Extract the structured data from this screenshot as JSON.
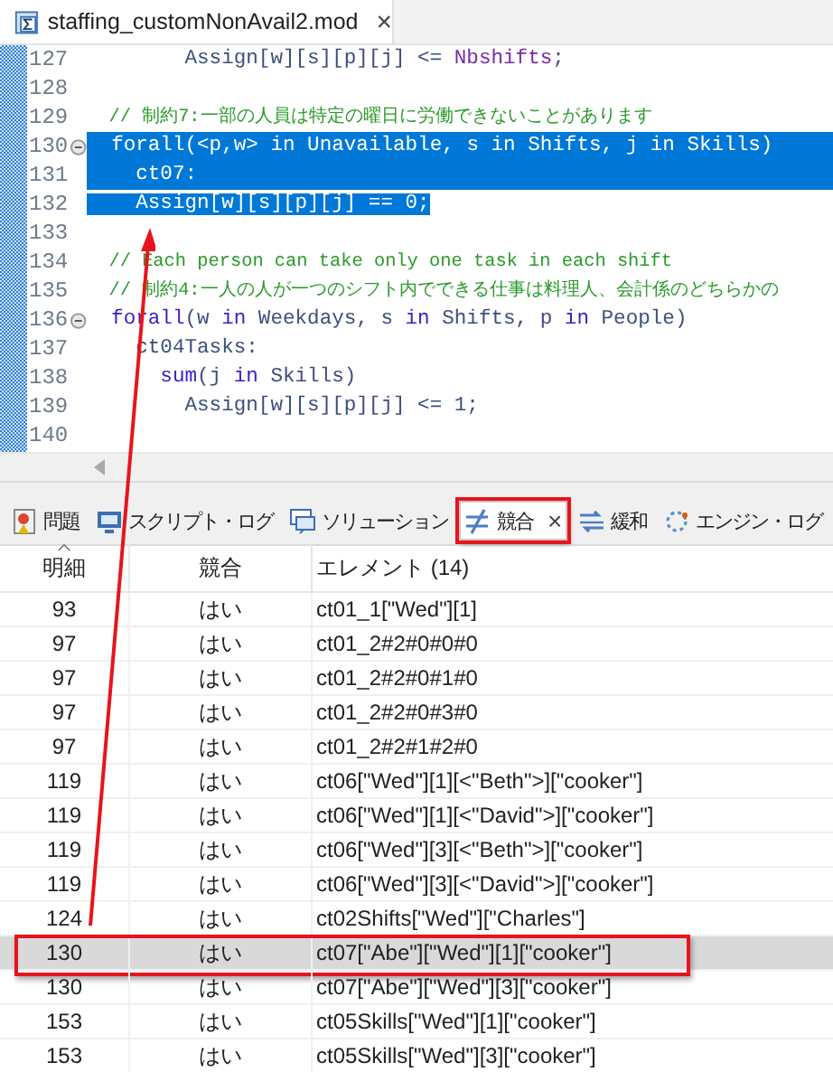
{
  "editor_tab": {
    "title": "staffing_customNonAvail2.mod",
    "close": "×"
  },
  "code_lines": [
    {
      "number": "127",
      "fold": false,
      "selected_to_end": false,
      "tokens": [
        {
          "kind": "plain",
          "text": "        Assign[w][s][p][j] <= ",
          "selected": false
        },
        {
          "kind": "ident",
          "text": "Nbshifts",
          "selected": false
        },
        {
          "kind": "plain",
          "text": ";",
          "selected": false
        }
      ]
    },
    {
      "number": "128",
      "fold": false,
      "selected_to_end": false
    },
    {
      "number": "129",
      "fold": false,
      "selected_to_end": false,
      "tokens": [
        {
          "kind": "comment",
          "text": "  // 制約7:一部の人員は特定の曜日に労働できないことがあります",
          "selected": false
        }
      ]
    },
    {
      "number": "130",
      "fold": true,
      "selected_to_end": true,
      "indent_selected": false,
      "tokens": [
        {
          "kind": "keyword",
          "text": "  forall",
          "selected": true
        },
        {
          "kind": "plain",
          "text": "(<p,w> ",
          "selected": true
        },
        {
          "kind": "keyword",
          "text": "in",
          "selected": true
        },
        {
          "kind": "plain",
          "text": " Unavailable, s ",
          "selected": true
        },
        {
          "kind": "keyword",
          "text": "in",
          "selected": true
        },
        {
          "kind": "plain",
          "text": " Shifts, j ",
          "selected": true
        },
        {
          "kind": "keyword",
          "text": "in",
          "selected": true
        },
        {
          "kind": "plain",
          "text": " Skills)",
          "selected": true
        }
      ]
    },
    {
      "number": "131",
      "fold": false,
      "selected_to_end": true,
      "indent_selected": true,
      "tokens": [
        {
          "kind": "plain",
          "text": "    ct07:",
          "selected": true
        }
      ]
    },
    {
      "number": "132",
      "fold": false,
      "selected_to_end": false,
      "indent_selected": true,
      "tokens": [
        {
          "kind": "plain",
          "text": "    Assign[w][s][p][j] == 0;",
          "selected": true
        }
      ]
    },
    {
      "number": "133",
      "fold": false,
      "selected_to_end": false
    },
    {
      "number": "134",
      "fold": false,
      "selected_to_end": false,
      "tokens": [
        {
          "kind": "comment",
          "text": "  // Each person can take only one task in each shift",
          "selected": false
        }
      ]
    },
    {
      "number": "135",
      "fold": false,
      "selected_to_end": false,
      "tokens": [
        {
          "kind": "comment",
          "text": "  // 制約4:一人の人が一つのシフト内でできる仕事は料理人、会計係のどちらかの",
          "selected": false
        }
      ]
    },
    {
      "number": "136",
      "fold": true,
      "selected_to_end": false,
      "tokens": [
        {
          "kind": "keyword",
          "text": "  forall",
          "selected": false
        },
        {
          "kind": "plain",
          "text": "(w ",
          "selected": false
        },
        {
          "kind": "keyword",
          "text": "in",
          "selected": false
        },
        {
          "kind": "plain",
          "text": " Weekdays, s ",
          "selected": false
        },
        {
          "kind": "keyword",
          "text": "in",
          "selected": false
        },
        {
          "kind": "plain",
          "text": " Shifts, p ",
          "selected": false
        },
        {
          "kind": "keyword",
          "text": "in",
          "selected": false
        },
        {
          "kind": "plain",
          "text": " People)",
          "selected": false
        }
      ]
    },
    {
      "number": "137",
      "fold": false,
      "selected_to_end": false,
      "tokens": [
        {
          "kind": "plain",
          "text": "    ct04Tasks:",
          "selected": false
        }
      ]
    },
    {
      "number": "138",
      "fold": false,
      "selected_to_end": false,
      "tokens": [
        {
          "kind": "keyword",
          "text": "      sum",
          "selected": false
        },
        {
          "kind": "plain",
          "text": "(j ",
          "selected": false
        },
        {
          "kind": "keyword",
          "text": "in",
          "selected": false
        },
        {
          "kind": "plain",
          "text": " Skills)",
          "selected": false
        }
      ]
    },
    {
      "number": "139",
      "fold": false,
      "selected_to_end": false,
      "tokens": [
        {
          "kind": "plain",
          "text": "        Assign[w][s][p][j] <= 1;",
          "selected": false
        }
      ]
    },
    {
      "number": "140",
      "fold": false,
      "selected_to_end": false
    }
  ],
  "view_tabs": [
    {
      "kind": "problems",
      "label": "問題",
      "selected": false,
      "annotated": false
    },
    {
      "kind": "script-log",
      "label": "スクリプト・ログ",
      "selected": false,
      "annotated": false
    },
    {
      "kind": "solutions",
      "label": "ソリューション",
      "selected": false,
      "annotated": false
    },
    {
      "kind": "conflicts",
      "label": "競合",
      "selected": true,
      "annotated": true,
      "close": "×"
    },
    {
      "kind": "relaxations",
      "label": "緩和",
      "selected": false,
      "annotated": false
    },
    {
      "kind": "engine-log",
      "label": "エンジン・ログ",
      "selected": false,
      "annotated": false
    }
  ],
  "table": {
    "columns": [
      "明細",
      "競合",
      "エレメント (14)"
    ],
    "rows": [
      {
        "line": "93",
        "conflict": "はい",
        "element": "ct01_1[\"Wed\"][1]",
        "selected": false,
        "annotated": false
      },
      {
        "line": "97",
        "conflict": "はい",
        "element": "ct01_2#2#0#0#0",
        "selected": false,
        "annotated": false
      },
      {
        "line": "97",
        "conflict": "はい",
        "element": "ct01_2#2#0#1#0",
        "selected": false,
        "annotated": false
      },
      {
        "line": "97",
        "conflict": "はい",
        "element": "ct01_2#2#0#3#0",
        "selected": false,
        "annotated": false
      },
      {
        "line": "97",
        "conflict": "はい",
        "element": "ct01_2#2#1#2#0",
        "selected": false,
        "annotated": false
      },
      {
        "line": "119",
        "conflict": "はい",
        "element": "ct06[\"Wed\"][1][<\"Beth\">][\"cooker\"]",
        "selected": false,
        "annotated": false
      },
      {
        "line": "119",
        "conflict": "はい",
        "element": "ct06[\"Wed\"][1][<\"David\">][\"cooker\"]",
        "selected": false,
        "annotated": false
      },
      {
        "line": "119",
        "conflict": "はい",
        "element": "ct06[\"Wed\"][3][<\"Beth\">][\"cooker\"]",
        "selected": false,
        "annotated": false
      },
      {
        "line": "119",
        "conflict": "はい",
        "element": "ct06[\"Wed\"][3][<\"David\">][\"cooker\"]",
        "selected": false,
        "annotated": false
      },
      {
        "line": "124",
        "conflict": "はい",
        "element": "ct02Shifts[\"Wed\"][\"Charles\"]",
        "selected": false,
        "annotated": false
      },
      {
        "line": "130",
        "conflict": "はい",
        "element": "ct07[\"Abe\"][\"Wed\"][1][\"cooker\"]",
        "selected": true,
        "annotated": true
      },
      {
        "line": "130",
        "conflict": "はい",
        "element": "ct07[\"Abe\"][\"Wed\"][3][\"cooker\"]",
        "selected": false,
        "annotated": false
      },
      {
        "line": "153",
        "conflict": "はい",
        "element": "ct05Skills[\"Wed\"][1][\"cooker\"]",
        "selected": false,
        "annotated": false
      },
      {
        "line": "153",
        "conflict": "はい",
        "element": "ct05Skills[\"Wed\"][3][\"cooker\"]",
        "selected": false,
        "annotated": false
      }
    ]
  }
}
